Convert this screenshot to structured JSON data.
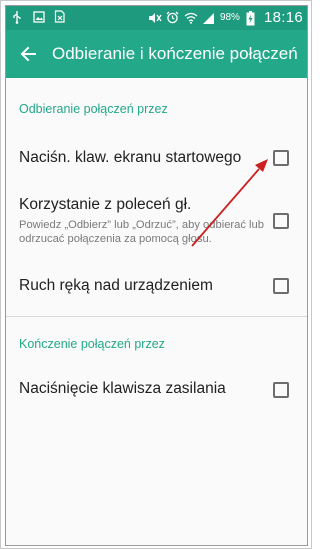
{
  "statusbar": {
    "left_icons": [
      "usb-icon",
      "image-icon",
      "no-file-icon"
    ],
    "right_icons": [
      "mute-icon",
      "alarm-icon",
      "wifi-icon",
      "signal-icon"
    ],
    "battery_text": "98%",
    "time": "18:16"
  },
  "appbar": {
    "title": "Odbieranie i kończenie połączeń"
  },
  "sections": {
    "answering": {
      "header": "Odbieranie połączeń przez",
      "rows": [
        {
          "title": "Naciśn. klaw. ekranu startowego",
          "checked": false
        },
        {
          "title": "Korzystanie z poleceń gł.",
          "description": "Powiedz „Odbierz” lub „Odrzuć”, aby odbierać lub odrzucać połączenia za pomocą głosu.",
          "checked": false
        },
        {
          "title": "Ruch ręką nad urządzeniem",
          "checked": false
        }
      ]
    },
    "ending": {
      "header": "Kończenie połączeń przez",
      "rows": [
        {
          "title": "Naciśnięcie klawisza zasilania",
          "checked": false
        }
      ]
    }
  },
  "colors": {
    "statusbar": "#1e9b7e",
    "appbar": "#23a88a",
    "accent": "#23a88a",
    "annotation_arrow": "#cc1f1f"
  }
}
